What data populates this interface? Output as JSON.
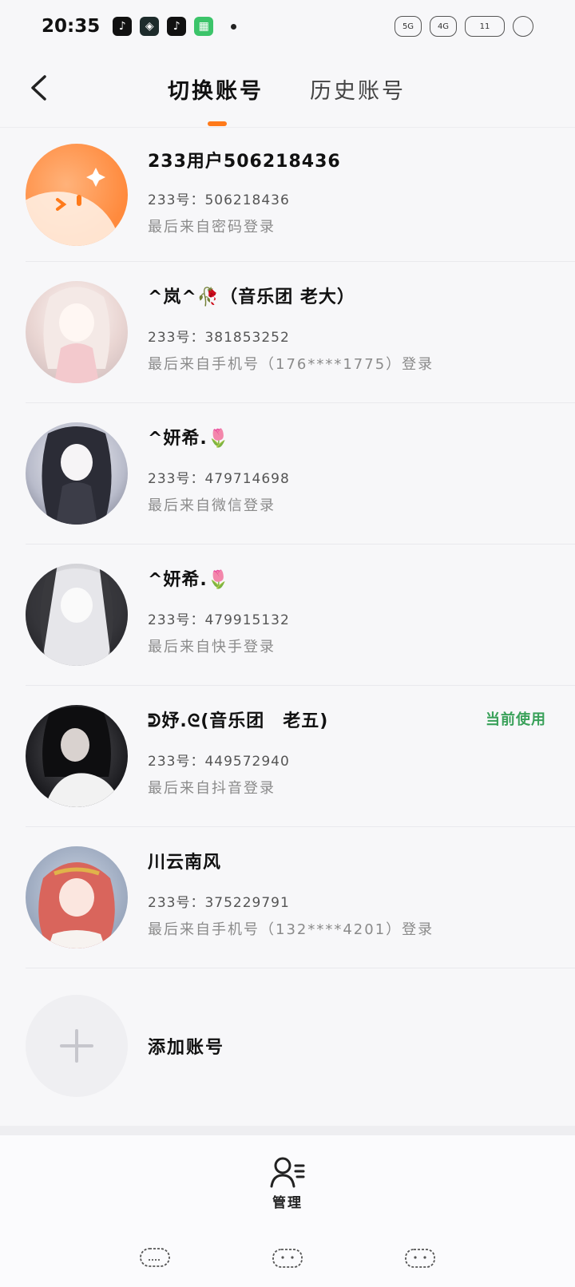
{
  "status_bar": {
    "time": "20:35",
    "right_labels": [
      "5G",
      "4G",
      "11"
    ]
  },
  "header": {
    "tabs": [
      {
        "label": "切换账号",
        "active": true
      },
      {
        "label": "历史账号",
        "active": false
      }
    ],
    "accent_color": "#ff7a1a"
  },
  "accounts": [
    {
      "name": "233用户506218436",
      "id": "233号：506218436",
      "login": "最后来自密码登录",
      "current": ""
    },
    {
      "name": "^岚^🥀（音乐团 老大）",
      "id": "233号：381853252",
      "login": "最后来自手机号（176****1775）登录",
      "current": ""
    },
    {
      "name": "^妍希.🌷",
      "id": "233号：479714698",
      "login": "最后来自微信登录",
      "current": ""
    },
    {
      "name": "^妍希.🌷",
      "id": "233号：479915132",
      "login": "最后来自快手登录",
      "current": ""
    },
    {
      "name": "ᕲ妤.ᘓ(音乐团　老五)",
      "id": "233号：449572940",
      "login": "最后来自抖音登录",
      "current": "当前使用"
    },
    {
      "name": "川云南风",
      "id": "233号：375229791",
      "login": "最后来自手机号（132****4201）登录",
      "current": ""
    }
  ],
  "add_account": {
    "label": "添加账号"
  },
  "manage": {
    "label": "管理"
  },
  "current_color": "#3aa15a"
}
